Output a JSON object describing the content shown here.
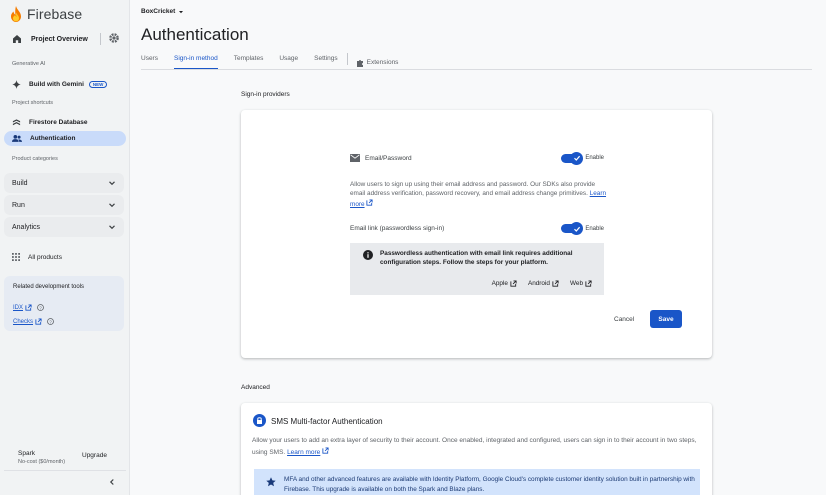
{
  "sidebar": {
    "brand": "Firebase",
    "project_overview": "Project Overview",
    "section_generative_ai": "Generative AI",
    "build_with_gemini": "Build with Gemini",
    "new_badge": "NEW",
    "section_project_shortcuts": "Project shortcuts",
    "firestore": "Firestore Database",
    "authentication": "Authentication",
    "section_product_categories": "Product categories",
    "categories": [
      "Build",
      "Run",
      "Analytics"
    ],
    "all_products": "All products",
    "tools_title": "Related development tools",
    "tools": [
      "IDX",
      "Checks"
    ],
    "plan_name": "Spark",
    "plan_sub": "No-cost ($0/month)",
    "upgrade": "Upgrade"
  },
  "header": {
    "project": "BoxCricket",
    "title": "Authentication",
    "tabs": [
      "Users",
      "Sign-in method",
      "Templates",
      "Usage",
      "Settings",
      "Extensions"
    ]
  },
  "providers": {
    "heading": "Sign-in providers",
    "email_label": "Email/Password",
    "enable": "Enable",
    "email_desc": "Allow users to sign up using their email address and password. Our SDKs also provide email address verification, password recovery, and email address change primitives.",
    "learn_more": "Learn more",
    "email_link_label": "Email link (passwordless sign-in)",
    "info_text": "Passwordless authentication with email link requires additional configuration steps. Follow the steps for your platform.",
    "platforms": [
      "Apple",
      "Android",
      "Web"
    ],
    "cancel": "Cancel",
    "save": "Save"
  },
  "advanced": {
    "heading": "Advanced",
    "sms_title": "SMS Multi-factor Authentication",
    "sms_desc": "Allow your users to add an extra layer of security to their account. Once enabled, integrated and configured, users can sign in to their account in two steps, using SMS.",
    "learn_more": "Learn more",
    "mfa_text": "MFA and other advanced features are available with Identity Platform, Google Cloud's complete customer identity solution built in partnership with Firebase. This upgrade is available on both the Spark and Blaze plans."
  },
  "colors": {
    "accent": "#1a56c8",
    "active_nav": "#c9dbfa",
    "info_blue": "#d2e3fc"
  }
}
